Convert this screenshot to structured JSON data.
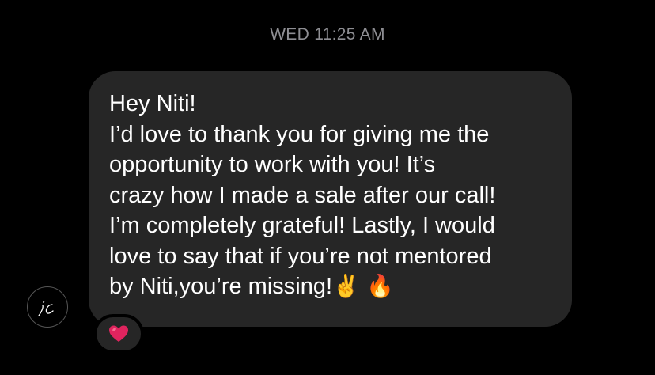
{
  "thread": {
    "timestamp": "WED 11:25 AM"
  },
  "message": {
    "greeting": "Hey Niti!",
    "lines": [
      "I’d love to thank you for giving me the",
      "opportunity to work with you! It’s",
      "crazy how I made a sale after our call!",
      "I’m completely grateful! Lastly, I would",
      "love to say that if you’re not mentored",
      "by Niti,you’re missing!"
    ],
    "emoji_1": "✌️",
    "emoji_2": "🔥"
  },
  "avatar": {
    "icon": "signature-logo-icon",
    "text": "ic"
  },
  "reaction": {
    "icon": "heart-icon",
    "emoji": "❤️",
    "color": "#e0245e"
  },
  "colors": {
    "background": "#000000",
    "bubble": "#262626",
    "timestamp": "#8e8e93",
    "text": "#ffffff"
  }
}
